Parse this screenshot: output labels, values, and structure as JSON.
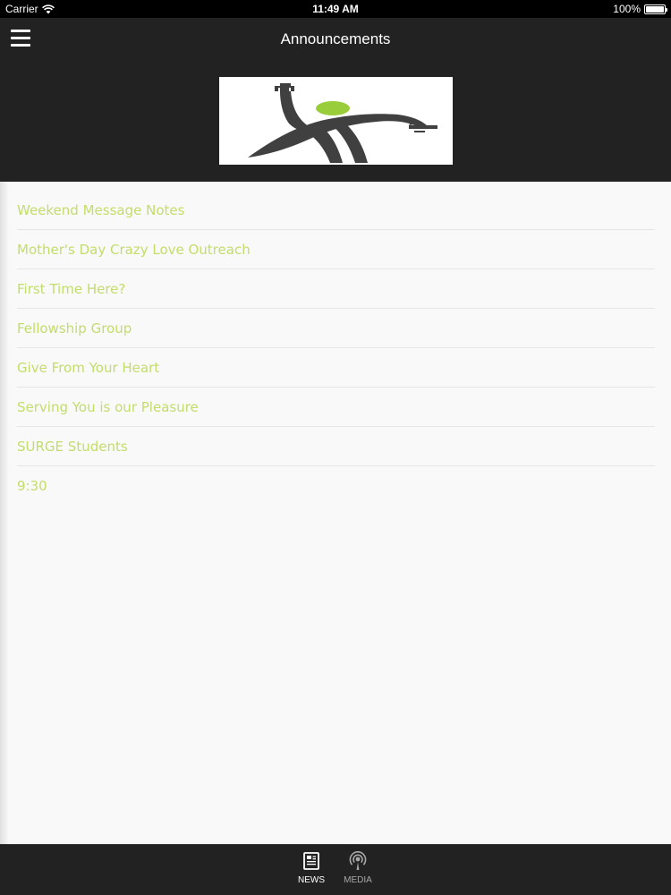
{
  "status_bar": {
    "carrier": "Carrier",
    "time": "11:49 AM",
    "battery": "100%"
  },
  "nav": {
    "title": "Announcements",
    "menu_icon": "hamburger-menu-icon"
  },
  "logo": {
    "icon": "church-logo-road-figure",
    "accent_color": "#9acd3a"
  },
  "announcements": [
    {
      "label": "Weekend Message Notes"
    },
    {
      "label": "Mother's Day Crazy Love Outreach"
    },
    {
      "label": "First Time Here?"
    },
    {
      "label": "Fellowship Group"
    },
    {
      "label": "Give From Your Heart"
    },
    {
      "label": "Serving You is our Pleasure"
    },
    {
      "label": "SURGE Students"
    },
    {
      "label": "9:30"
    }
  ],
  "tabs": [
    {
      "label": "NEWS",
      "icon": "news-icon",
      "selected": true
    },
    {
      "label": "MEDIA",
      "icon": "podcast-icon",
      "selected": false
    }
  ],
  "colors": {
    "bar_background": "#232222",
    "link_color": "#c3dd6a",
    "content_background": "#f9f9fa"
  }
}
